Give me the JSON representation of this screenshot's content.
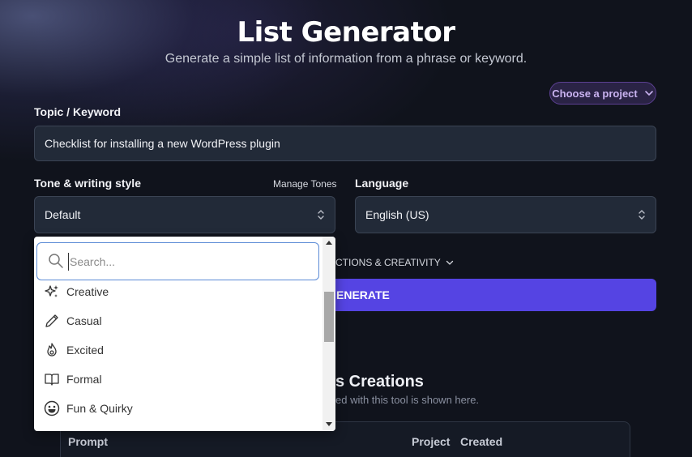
{
  "header": {
    "title": "List Generator",
    "subtitle": "Generate a simple list of information from a phrase or keyword."
  },
  "project_selector": {
    "label": "Choose a project"
  },
  "topic": {
    "label": "Topic / Keyword",
    "value": "Checklist for installing a new WordPress plugin"
  },
  "tone": {
    "label": "Tone & writing style",
    "manage_link": "Manage Tones",
    "selected": "Default"
  },
  "language": {
    "label": "Language",
    "selected": "English (US)"
  },
  "advanced": {
    "label": "CTIONS & CREATIVITY"
  },
  "generate": {
    "label": "ENERATE"
  },
  "creations": {
    "title": "s Creations",
    "subtitle": "ed with this tool is shown here.",
    "columns": [
      "Prompt",
      "Project",
      "Created"
    ]
  },
  "dropdown": {
    "search_placeholder": "Search...",
    "options": [
      {
        "label": "Creative",
        "icon": "sparkles-icon"
      },
      {
        "label": "Casual",
        "icon": "pencil-icon"
      },
      {
        "label": "Excited",
        "icon": "fire-icon"
      },
      {
        "label": "Formal",
        "icon": "book-icon"
      },
      {
        "label": "Fun & Quirky",
        "icon": "smile-icon"
      }
    ]
  },
  "colors": {
    "background": "#10131c",
    "accent": "#5544e3",
    "project_pill": "#2a2345",
    "field_bg": "#222a38"
  }
}
